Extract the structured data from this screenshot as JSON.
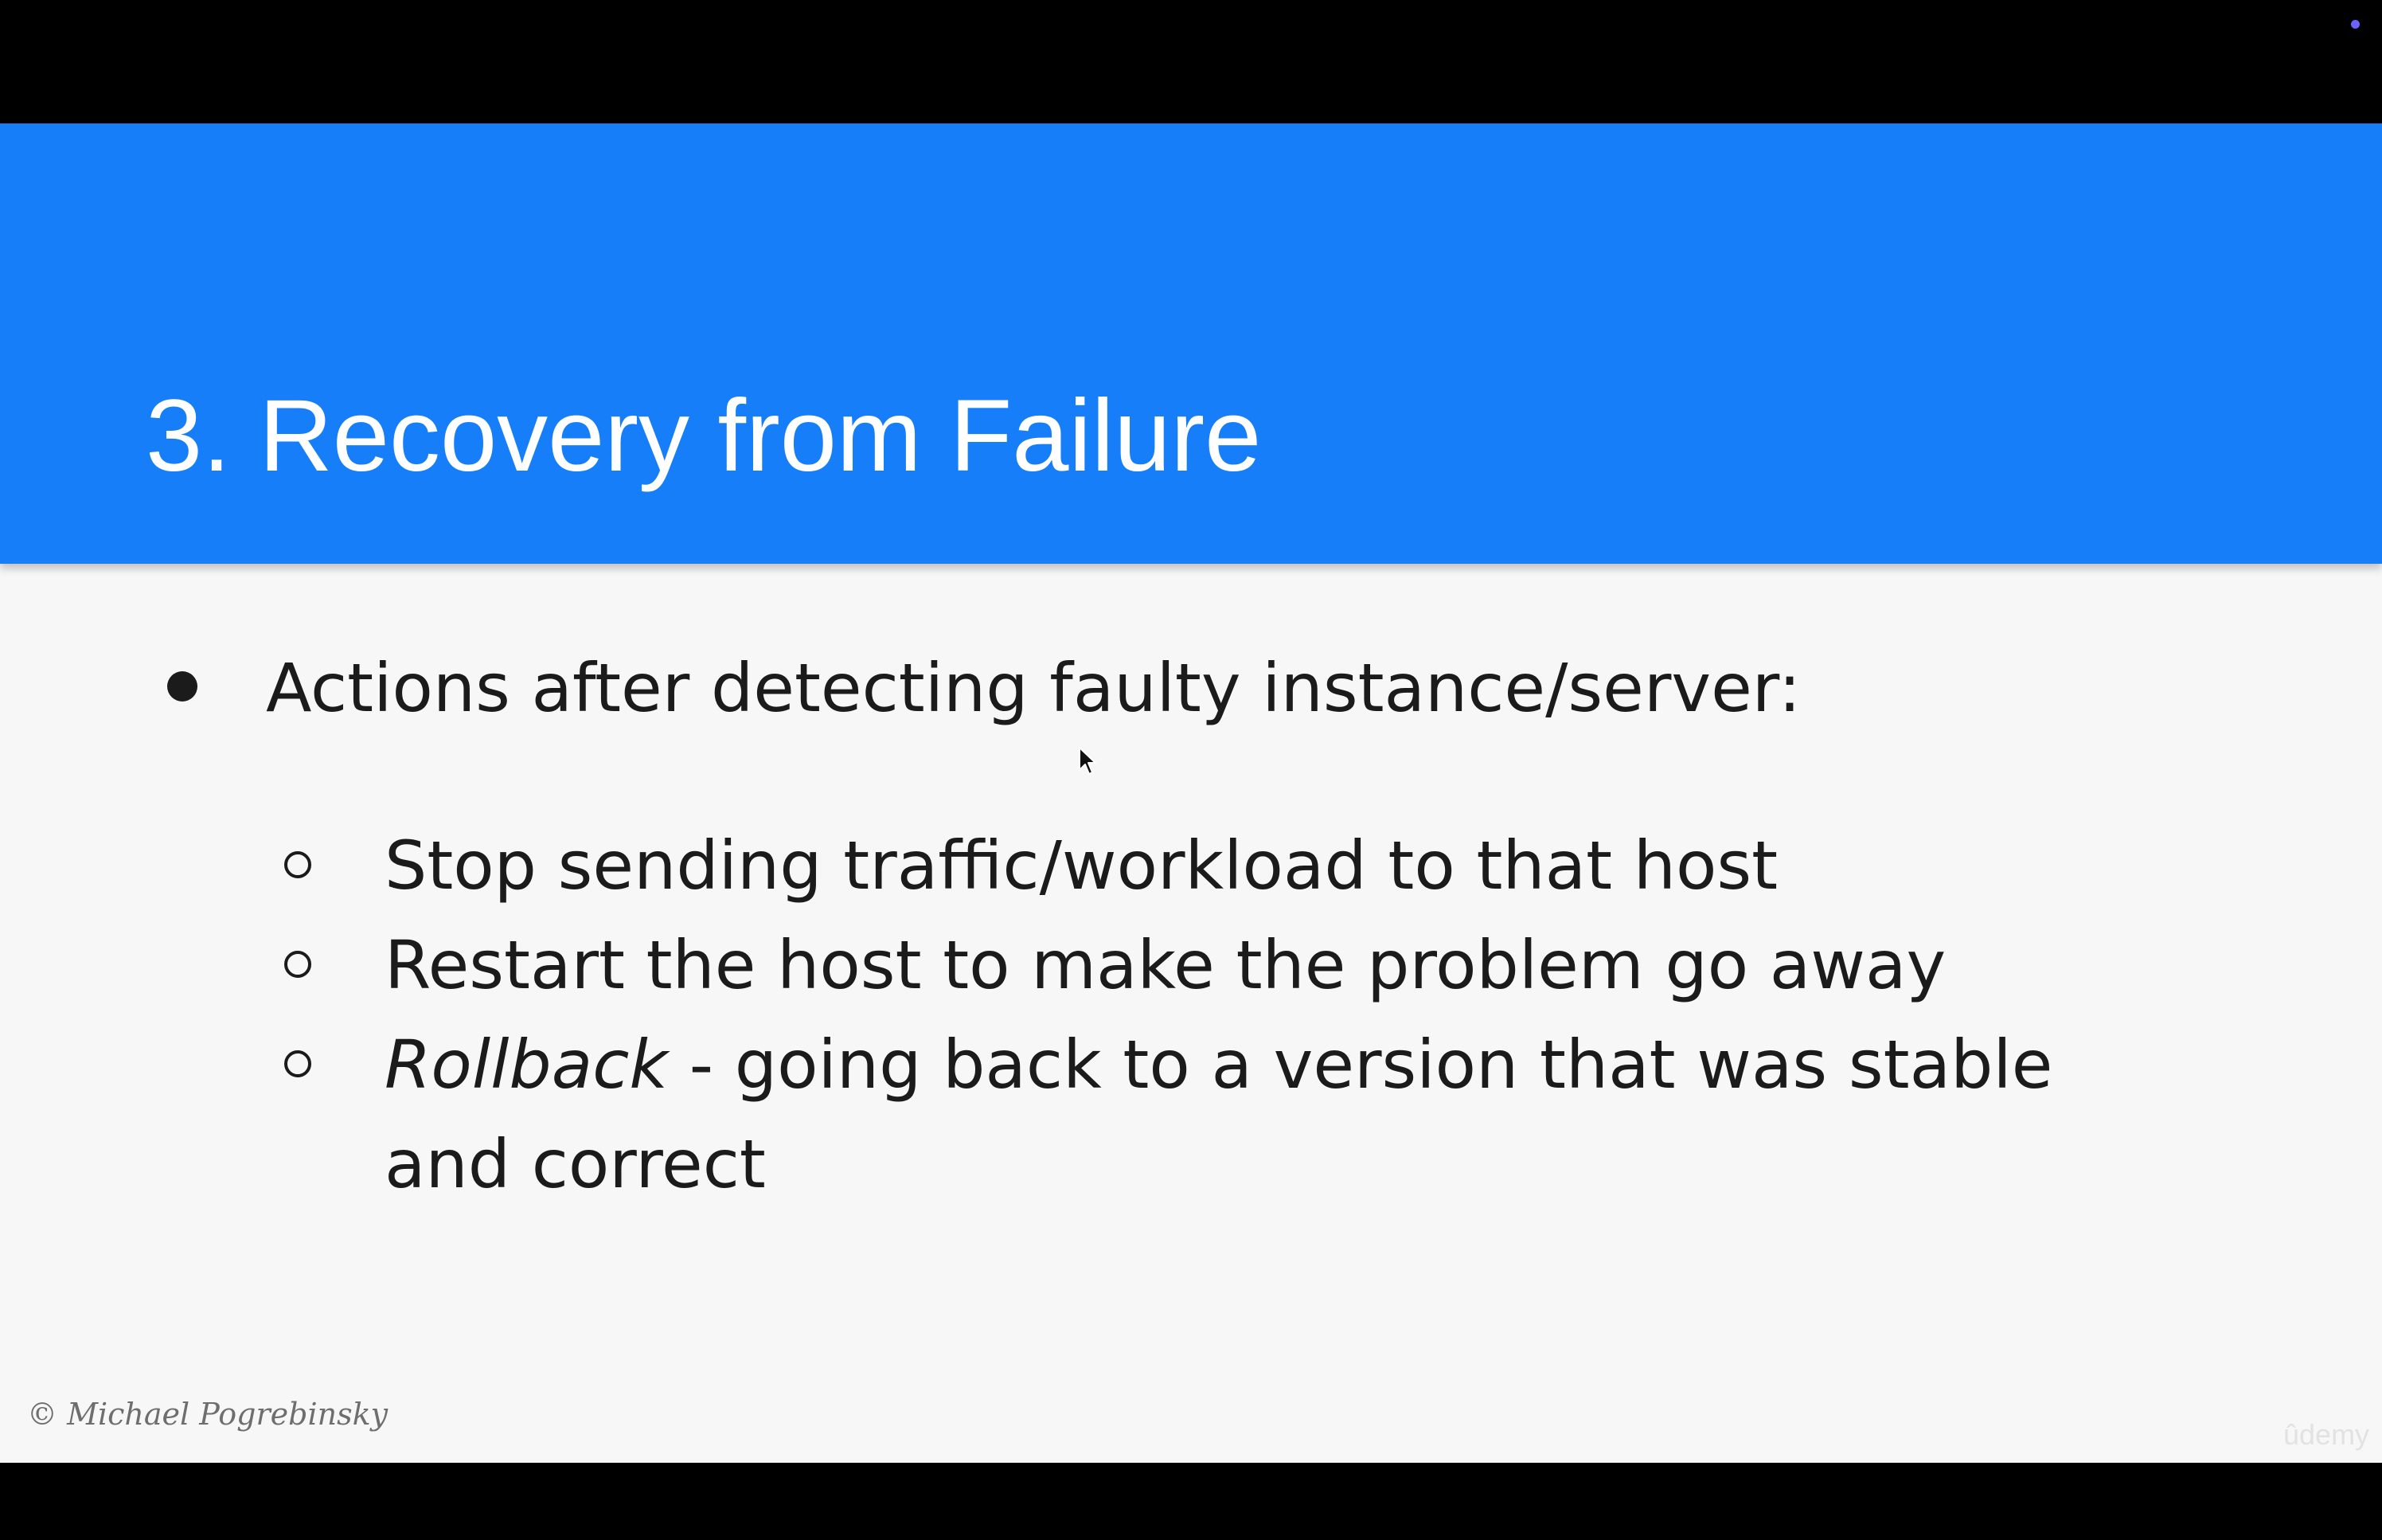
{
  "slide": {
    "title": "3. Recovery from Failure",
    "bullets": [
      {
        "text": "Actions after detecting faulty instance/server:",
        "sub_items": [
          {
            "emphasis": "",
            "text": "Stop sending traffic/workload to that host"
          },
          {
            "emphasis": "",
            "text": "Restart the host to make the problem go away"
          },
          {
            "emphasis": "Rollback",
            "text": " - going back to a version that was stable and correct"
          }
        ]
      }
    ],
    "copyright": "© Michael Pogrebinsky",
    "watermark": "ûdemy"
  },
  "colors": {
    "header_blue": "#167ef9",
    "slide_background": "#f7f7f7",
    "frame": "#000000",
    "indicator": "#6b63ff"
  },
  "icons": {
    "cursor": "mouse-pointer-icon",
    "bullet_l1": "filled-circle-bullet",
    "bullet_l2": "hollow-circle-bullet"
  }
}
